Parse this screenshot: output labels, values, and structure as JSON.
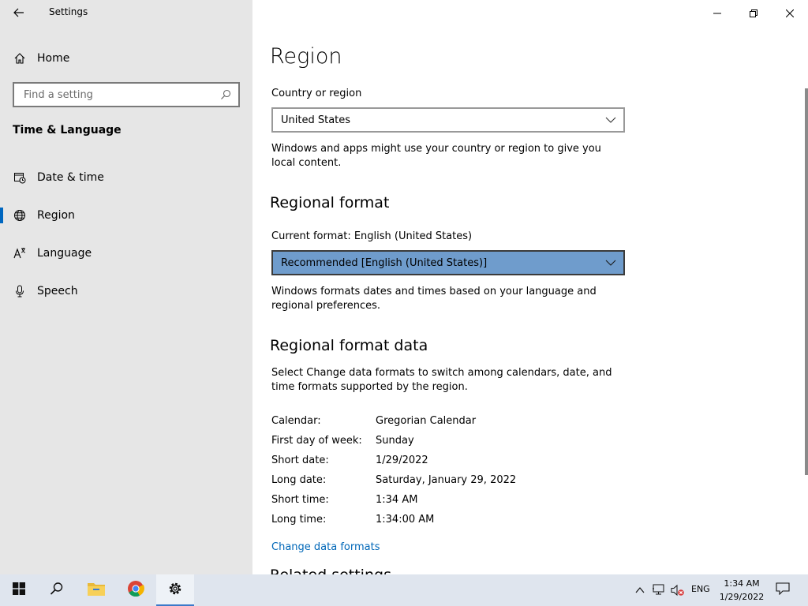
{
  "window": {
    "app_title": "Settings"
  },
  "sidebar": {
    "home_label": "Home",
    "search_placeholder": "Find a setting",
    "section_title": "Time & Language",
    "items": [
      {
        "label": "Date & time",
        "icon": "calendar-clock-icon"
      },
      {
        "label": "Region",
        "icon": "globe-icon",
        "active": true
      },
      {
        "label": "Language",
        "icon": "language-icon"
      },
      {
        "label": "Speech",
        "icon": "microphone-icon"
      }
    ]
  },
  "main": {
    "title": "Region",
    "country": {
      "label": "Country or region",
      "value": "United States",
      "description": "Windows and apps might use your country or region to give you local content."
    },
    "regional_format": {
      "heading": "Regional format",
      "current_label": "Current format: English (United States)",
      "value": "Recommended [English (United States)]",
      "description": "Windows formats dates and times based on your language and regional preferences."
    },
    "format_data": {
      "heading": "Regional format data",
      "description": "Select Change data formats to switch among calendars, date, and time formats supported by the region.",
      "rows": [
        {
          "key": "Calendar:",
          "value": "Gregorian Calendar"
        },
        {
          "key": "First day of week:",
          "value": "Sunday"
        },
        {
          "key": "Short date:",
          "value": "1/29/2022"
        },
        {
          "key": "Long date:",
          "value": "Saturday, January 29, 2022"
        },
        {
          "key": "Short time:",
          "value": "1:34 AM"
        },
        {
          "key": "Long time:",
          "value": "1:34:00 AM"
        }
      ],
      "change_link": "Change data formats"
    },
    "related_heading": "Related settings"
  },
  "taskbar": {
    "language": "ENG",
    "time": "1:34 AM",
    "date": "1/29/2022"
  },
  "colors": {
    "accent": "#0067c0",
    "selected_combo": "#6f9ccc",
    "link": "#0067b8",
    "sidebar_bg": "#e6e6e6",
    "taskbar_bg": "#dfe5ee"
  }
}
